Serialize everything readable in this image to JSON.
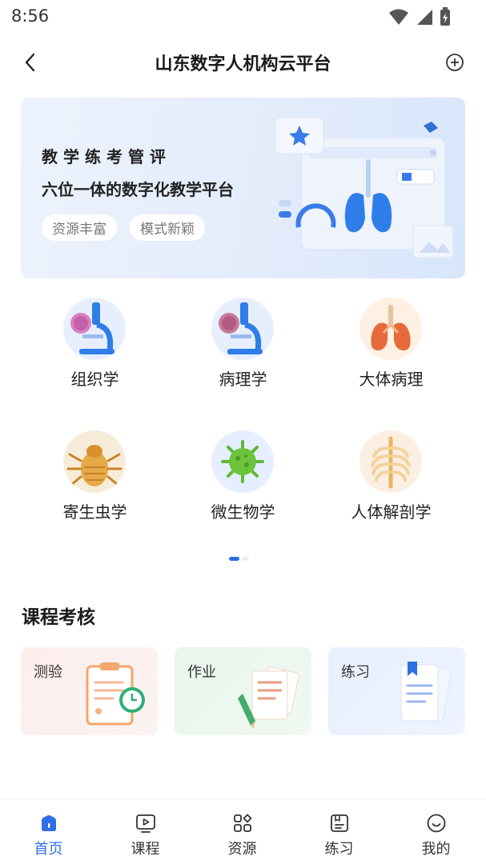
{
  "status_bar": {
    "time": "8:56"
  },
  "header": {
    "title": "山东数字人机构云平台",
    "back_icon": "chevron-left-icon",
    "add_icon": "plus-circle-icon"
  },
  "banner": {
    "headline": "教学练考管评",
    "subline": "六位一体的数字化教学平台",
    "tags": [
      "资源丰富",
      "模式新颖"
    ]
  },
  "subjects": [
    {
      "label": "组织学",
      "icon": "microscope-icon"
    },
    {
      "label": "病理学",
      "icon": "microscope-icon"
    },
    {
      "label": "大体病理",
      "icon": "lungs-icon"
    },
    {
      "label": "寄生虫学",
      "icon": "parasite-icon"
    },
    {
      "label": "微生物学",
      "icon": "virus-icon"
    },
    {
      "label": "人体解剖学",
      "icon": "ribcage-icon"
    }
  ],
  "pager": {
    "current_page": 1,
    "total_pages": 2
  },
  "course_section": {
    "title": "课程考核",
    "cards": [
      {
        "label": "测验",
        "icon": "clipboard-clock-icon"
      },
      {
        "label": "作业",
        "icon": "documents-pencil-icon"
      },
      {
        "label": "练习",
        "icon": "bookmarked-page-icon"
      }
    ]
  },
  "tab_bar": {
    "active_index": 0,
    "accent_color": "#2f6fe6",
    "tabs": [
      {
        "label": "首页",
        "icon": "home-icon"
      },
      {
        "label": "课程",
        "icon": "video-course-icon"
      },
      {
        "label": "资源",
        "icon": "grid-resources-icon"
      },
      {
        "label": "练习",
        "icon": "practice-icon"
      },
      {
        "label": "我的",
        "icon": "smile-profile-icon"
      }
    ]
  }
}
